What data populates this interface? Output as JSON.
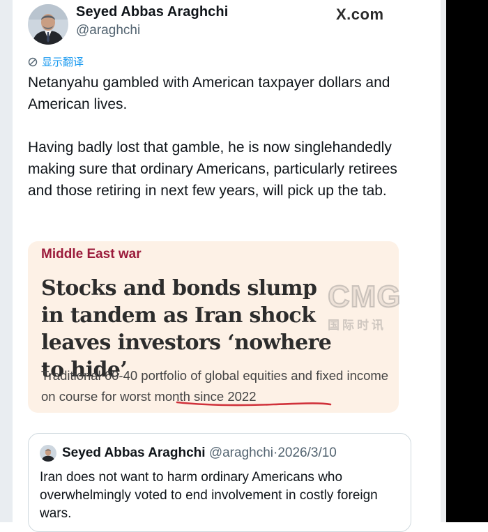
{
  "author": {
    "display_name": "Seyed Abbas Araghchi",
    "handle": "@araghchi"
  },
  "watermark": {
    "text": "X.com"
  },
  "translate": {
    "label": "显示翻译",
    "icon": "translate-icon"
  },
  "post": {
    "paragraph_1": "Netanyahu gambled with American taxpayer dollars and American lives.",
    "paragraph_2": "Having badly lost that gamble, he is now singlehandedly making sure that ordinary Americans, particularly retirees and those retiring in next few years, will pick up the tab."
  },
  "card": {
    "tag": "Middle East war",
    "headline": "Stocks and bonds slump in tandem as Iran shock leaves investors ‘nowhere to hide’",
    "sub_start": "Traditional 60-40 portfolio of global equities and fixed income on course for ",
    "sub_highlight": "worst month since 2022",
    "tag_color": "#9b1b3b",
    "background": "#fdf1e6"
  },
  "cmg_watermark": {
    "big": "CMG",
    "small": "国际时讯"
  },
  "quoted_post": {
    "display_name": "Seyed Abbas Araghchi",
    "handle": "@araghchi",
    "separator": "·",
    "date": "2026/3/10",
    "text": "Iran does not want to harm ordinary Americans who overwhelmingly voted to end involvement in costly foreign wars."
  },
  "colors": {
    "link": "#1d9bf0",
    "secondary_text": "#536471",
    "underline": "#d0313a"
  }
}
